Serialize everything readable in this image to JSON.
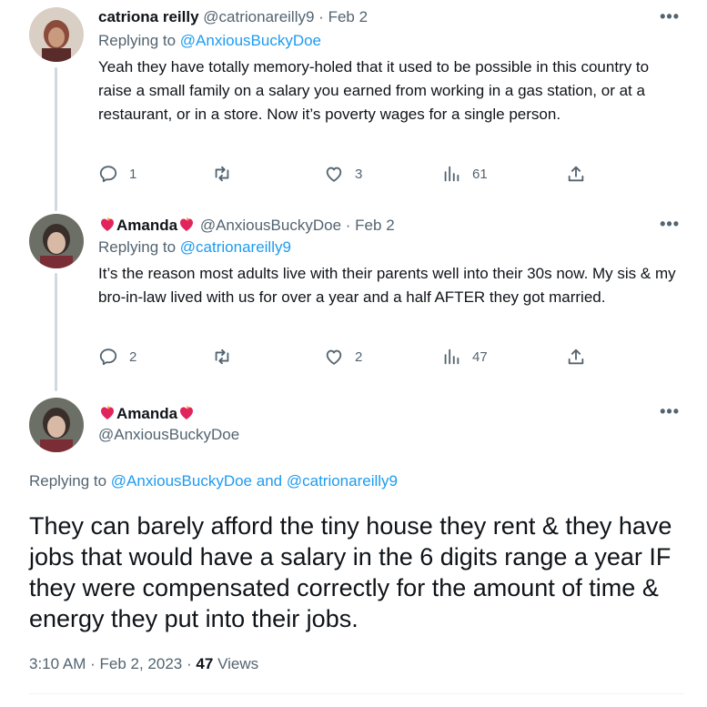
{
  "tweets": [
    {
      "display_name": "catriona reilly",
      "handle": "@catrionareilly9",
      "date": "Feb 2",
      "replying_to_prefix": "Replying to",
      "replying_to": "@AnxiousBuckyDoe",
      "body": "Yeah they have totally memory-holed that it used to be possible in this country to raise a small family on a salary you earned from working in a gas station, or at a restaurant, or in a store. Now it’s poverty wages for a single person.",
      "replies": "1",
      "retweets": "",
      "likes": "3",
      "views": "61"
    },
    {
      "display_name": "Amanda",
      "handle": "@AnxiousBuckyDoe",
      "date": "Feb 2",
      "replying_to_prefix": "Replying to",
      "replying_to": "@catrionareilly9",
      "body": "It’s the reason most adults live with their parents well into their 30s now. My sis & my bro-in-law lived with us for over a year and a half AFTER they got married.",
      "replies": "2",
      "retweets": "",
      "likes": "2",
      "views": "47"
    }
  ],
  "main": {
    "display_name": "Amanda",
    "handle": "@AnxiousBuckyDoe",
    "replying_to_prefix": "Replying to",
    "replying_to_1": "@AnxiousBuckyDoe",
    "replying_and": "and",
    "replying_to_2": "@catrionareilly9",
    "body": "They can barely afford the tiny house they rent & they have jobs that would have a salary in the 6 digits range a year IF they were compensated correctly for the amount of time & energy they put into their jobs.",
    "time": "3:10 AM",
    "date": "Feb 2, 2023",
    "views_count": "47",
    "views_label": "Views"
  },
  "separator": "·",
  "more_label": "•••",
  "colors": {
    "accent": "#1d9bf0",
    "muted": "#536471",
    "thread_line": "#cfd9de",
    "heart_emoji": "#e0245e"
  },
  "icons": [
    "reply-icon",
    "retweet-icon",
    "like-icon",
    "views-icon",
    "share-icon",
    "more-icon",
    "heart-on-fire-emoji"
  ]
}
